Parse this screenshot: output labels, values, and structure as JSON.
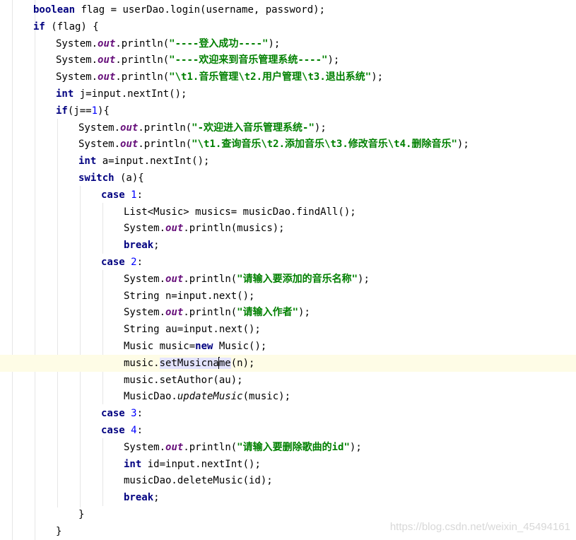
{
  "editor": {
    "lines": [
      {
        "id": "l1",
        "segments": [
          {
            "t": "boolean",
            "c": "kw"
          },
          {
            "t": " flag = userDao.login(username, password);"
          }
        ]
      },
      {
        "id": "l2",
        "segments": [
          {
            "t": "if",
            "c": "kw"
          },
          {
            "t": " (flag) {"
          }
        ]
      },
      {
        "id": "l3",
        "segments": [
          {
            "t": "System."
          },
          {
            "t": "out",
            "c": "fld"
          },
          {
            "t": ".println("
          },
          {
            "t": "\"----登入成功----\"",
            "c": "str"
          },
          {
            "t": ");"
          }
        ]
      },
      {
        "id": "l4",
        "segments": [
          {
            "t": "System."
          },
          {
            "t": "out",
            "c": "fld"
          },
          {
            "t": ".println("
          },
          {
            "t": "\"----欢迎来到音乐管理系统----\"",
            "c": "str"
          },
          {
            "t": ");"
          }
        ]
      },
      {
        "id": "l5",
        "segments": [
          {
            "t": "System."
          },
          {
            "t": "out",
            "c": "fld"
          },
          {
            "t": ".println("
          },
          {
            "t": "\"\\t1.音乐管理\\t2.用户管理\\t3.退出系统\"",
            "c": "str"
          },
          {
            "t": ");"
          }
        ]
      },
      {
        "id": "l6",
        "segments": [
          {
            "t": "int",
            "c": "kw"
          },
          {
            "t": " j=input.nextInt();"
          }
        ]
      },
      {
        "id": "l7",
        "segments": [
          {
            "t": "if",
            "c": "kw"
          },
          {
            "t": "(j=="
          },
          {
            "t": "1",
            "c": "num"
          },
          {
            "t": "){"
          }
        ]
      },
      {
        "id": "l8",
        "segments": [
          {
            "t": "System."
          },
          {
            "t": "out",
            "c": "fld"
          },
          {
            "t": ".println("
          },
          {
            "t": "\"-欢迎进入音乐管理系统-\"",
            "c": "str"
          },
          {
            "t": ");"
          }
        ]
      },
      {
        "id": "l9",
        "segments": [
          {
            "t": "System."
          },
          {
            "t": "out",
            "c": "fld"
          },
          {
            "t": ".println("
          },
          {
            "t": "\"\\t1.查询音乐\\t2.添加音乐\\t3.修改音乐\\t4.删除音乐\"",
            "c": "str"
          },
          {
            "t": ");"
          }
        ]
      },
      {
        "id": "l10",
        "segments": [
          {
            "t": "int",
            "c": "kw"
          },
          {
            "t": " a=input.nextInt();"
          }
        ]
      },
      {
        "id": "l11",
        "segments": [
          {
            "t": "switch",
            "c": "kw"
          },
          {
            "t": " (a){"
          }
        ]
      },
      {
        "id": "l12",
        "segments": [
          {
            "t": "case",
            "c": "kw"
          },
          {
            "t": " "
          },
          {
            "t": "1",
            "c": "num"
          },
          {
            "t": ":"
          }
        ]
      },
      {
        "id": "l13",
        "segments": [
          {
            "t": "List<Music> musics= musicDao.findAll();"
          }
        ]
      },
      {
        "id": "l14",
        "segments": [
          {
            "t": "System."
          },
          {
            "t": "out",
            "c": "fld"
          },
          {
            "t": ".println(musics);"
          }
        ]
      },
      {
        "id": "l15",
        "segments": [
          {
            "t": "break",
            "c": "kw"
          },
          {
            "t": ";"
          }
        ]
      },
      {
        "id": "l16",
        "segments": [
          {
            "t": "case",
            "c": "kw"
          },
          {
            "t": " "
          },
          {
            "t": "2",
            "c": "num"
          },
          {
            "t": ":"
          }
        ]
      },
      {
        "id": "l17",
        "segments": [
          {
            "t": "System."
          },
          {
            "t": "out",
            "c": "fld"
          },
          {
            "t": ".println("
          },
          {
            "t": "\"请输入要添加的音乐名称\"",
            "c": "str"
          },
          {
            "t": ");"
          }
        ]
      },
      {
        "id": "l18",
        "segments": [
          {
            "t": "String n=input.next();"
          }
        ]
      },
      {
        "id": "l19",
        "segments": [
          {
            "t": "System."
          },
          {
            "t": "out",
            "c": "fld"
          },
          {
            "t": ".println("
          },
          {
            "t": "\"请输入作者\"",
            "c": "str"
          },
          {
            "t": ");"
          }
        ]
      },
      {
        "id": "l20",
        "segments": [
          {
            "t": "String au=input.next();"
          }
        ]
      },
      {
        "id": "l21",
        "segments": [
          {
            "t": "Music music="
          },
          {
            "t": "new",
            "c": "kw"
          },
          {
            "t": " Music();"
          }
        ]
      },
      {
        "id": "l22",
        "segments": [
          {
            "t": "music."
          },
          {
            "t": "setMusicna",
            "c": "hl"
          },
          {
            "t": "",
            "c": "caret"
          },
          {
            "t": "me",
            "c": "hl"
          },
          {
            "t": "(n);"
          }
        ]
      },
      {
        "id": "l23",
        "segments": [
          {
            "t": "music.setAuthor(au);"
          }
        ]
      },
      {
        "id": "l24",
        "segments": [
          {
            "t": "MusicDao."
          },
          {
            "t": "updateMusic",
            "c": "st"
          },
          {
            "t": "(music);"
          }
        ]
      },
      {
        "id": "l25",
        "segments": [
          {
            "t": "case",
            "c": "kw"
          },
          {
            "t": " "
          },
          {
            "t": "3",
            "c": "num"
          },
          {
            "t": ":"
          }
        ]
      },
      {
        "id": "l26",
        "segments": [
          {
            "t": "case",
            "c": "kw"
          },
          {
            "t": " "
          },
          {
            "t": "4",
            "c": "num"
          },
          {
            "t": ":"
          }
        ]
      },
      {
        "id": "l27",
        "segments": [
          {
            "t": "System."
          },
          {
            "t": "out",
            "c": "fld"
          },
          {
            "t": ".println("
          },
          {
            "t": "\"请输入要删除歌曲的id\"",
            "c": "str"
          },
          {
            "t": ");"
          }
        ]
      },
      {
        "id": "l28",
        "segments": [
          {
            "t": "int",
            "c": "kw"
          },
          {
            "t": " id=input.nextInt();"
          }
        ]
      },
      {
        "id": "l29",
        "segments": [
          {
            "t": "musicDao.deleteMusic(id);"
          }
        ]
      },
      {
        "id": "l30",
        "segments": [
          {
            "t": "break",
            "c": "kw"
          },
          {
            "t": ";"
          }
        ]
      },
      {
        "id": "l31",
        "segments": [
          {
            "t": "}"
          }
        ]
      },
      {
        "id": "l32",
        "segments": [
          {
            "t": "}"
          }
        ]
      }
    ]
  },
  "watermark": "https://blog.csdn.net/weixin_45494161",
  "colors": {
    "keyword": "#000080",
    "string": "#008000",
    "number": "#0000ff",
    "static_field": "#660e7a",
    "current_line": "#fefce6",
    "usage_highlight": "#e4e4ff"
  }
}
